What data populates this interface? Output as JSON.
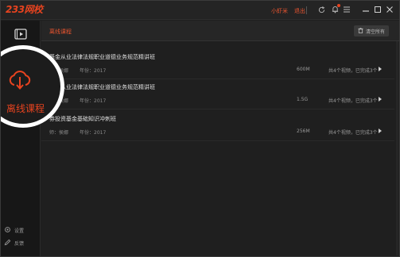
{
  "app": {
    "logo": "233网校",
    "user_name": "小虾米",
    "logout": "退出"
  },
  "sidebar": {
    "settings_label": "设置",
    "feedback_label": "反馈"
  },
  "spotlight": {
    "label": "离线课程"
  },
  "main": {
    "section_title": "离线课程",
    "clear_all_label": "清空所有"
  },
  "courses": [
    {
      "title": "基金从业法律法规职业道德业务规范精讲班",
      "teacher": "师：侯娜",
      "year": "年份：2017",
      "size": "600M",
      "count": "共4个视频，已完成3个"
    },
    {
      "title": "基金从业法律法规职业道德业务规范精讲班",
      "teacher": "师：侯娜",
      "year": "年份：2017",
      "size": "1.5G",
      "count": "共4个视频，已完成3个"
    },
    {
      "title": "券投资基金基础知识冲刺班",
      "teacher": "师：侯娜",
      "year": "年份：2017",
      "size": "256M",
      "count": "共4个视频，已完成3个"
    }
  ],
  "colors": {
    "accent": "#e8431f",
    "background": "#1f1f1f",
    "sidebar": "#171717"
  }
}
